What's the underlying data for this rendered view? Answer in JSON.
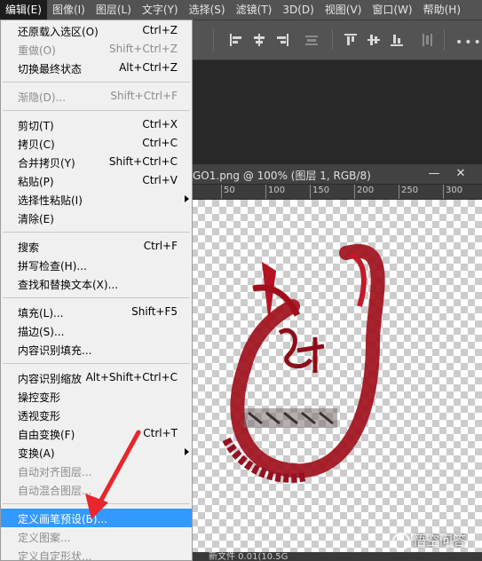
{
  "menubar": {
    "items": [
      "编辑(E)",
      "图像(I)",
      "图层(L)",
      "文字(Y)",
      "选择(S)",
      "滤镜(T)",
      "3D(D)",
      "视图(V)",
      "窗口(W)",
      "帮助(H)"
    ]
  },
  "toolbar": {
    "icons": [
      "align-left-icon",
      "align-center-h-icon",
      "align-right-icon",
      "distribute-h-icon",
      "align-top-icon",
      "align-center-v-icon",
      "align-bottom-icon",
      "distribute-v-icon",
      "more-icon"
    ],
    "more_label": "•••"
  },
  "document": {
    "tab_title": "GO1.png @ 100% (图层 1, RGB/8)",
    "minimize_glyph": "—",
    "close_glyph": "✕",
    "ruler_labels": [
      "50",
      "100",
      "150",
      "200",
      "250",
      "300"
    ],
    "status_text": "新文件 0.01(10.5G"
  },
  "watermark": {
    "text": "悟空问答"
  },
  "edit_menu": {
    "items": [
      {
        "label": "还原载入选区(O)",
        "shortcut": "Ctrl+Z",
        "enabled": true
      },
      {
        "label": "重做(O)",
        "shortcut": "Shift+Ctrl+Z",
        "enabled": false
      },
      {
        "label": "切换最终状态",
        "shortcut": "Alt+Ctrl+Z",
        "enabled": true
      },
      {
        "label": "渐隐(D)...",
        "shortcut": "Shift+Ctrl+F",
        "enabled": false
      },
      {
        "label": "剪切(T)",
        "shortcut": "Ctrl+X",
        "enabled": true
      },
      {
        "label": "拷贝(C)",
        "shortcut": "Ctrl+C",
        "enabled": true
      },
      {
        "label": "合并拷贝(Y)",
        "shortcut": "Shift+Ctrl+C",
        "enabled": true
      },
      {
        "label": "粘贴(P)",
        "shortcut": "Ctrl+V",
        "enabled": true
      },
      {
        "label": "选择性粘贴(I)",
        "shortcut": "",
        "enabled": true,
        "submenu": true
      },
      {
        "label": "清除(E)",
        "shortcut": "",
        "enabled": true
      },
      {
        "label": "搜索",
        "shortcut": "Ctrl+F",
        "enabled": true
      },
      {
        "label": "拼写检查(H)...",
        "shortcut": "",
        "enabled": true
      },
      {
        "label": "查找和替换文本(X)...",
        "shortcut": "",
        "enabled": true
      },
      {
        "label": "填充(L)...",
        "shortcut": "Shift+F5",
        "enabled": true
      },
      {
        "label": "描边(S)...",
        "shortcut": "",
        "enabled": true
      },
      {
        "label": "内容识别填充...",
        "shortcut": "",
        "enabled": true
      },
      {
        "label": "内容识别缩放",
        "shortcut": "Alt+Shift+Ctrl+C",
        "enabled": true
      },
      {
        "label": "操控变形",
        "shortcut": "",
        "enabled": true
      },
      {
        "label": "透视变形",
        "shortcut": "",
        "enabled": true
      },
      {
        "label": "自由变换(F)",
        "shortcut": "Ctrl+T",
        "enabled": true
      },
      {
        "label": "变换(A)",
        "shortcut": "",
        "enabled": true,
        "submenu": true
      },
      {
        "label": "自动对齐图层...",
        "shortcut": "",
        "enabled": false
      },
      {
        "label": "自动混合图层...",
        "shortcut": "",
        "enabled": false
      },
      {
        "label": "定义画笔预设(B)...",
        "shortcut": "",
        "enabled": true,
        "highlighted": true
      },
      {
        "label": "定义图案...",
        "shortcut": "",
        "enabled": false
      },
      {
        "label": "定义自定形状...",
        "shortcut": "",
        "enabled": false
      }
    ]
  },
  "colors": {
    "menu_highlight": "#3399ff",
    "logo_red": "#b01020",
    "arrow_red": "#e8262b"
  }
}
